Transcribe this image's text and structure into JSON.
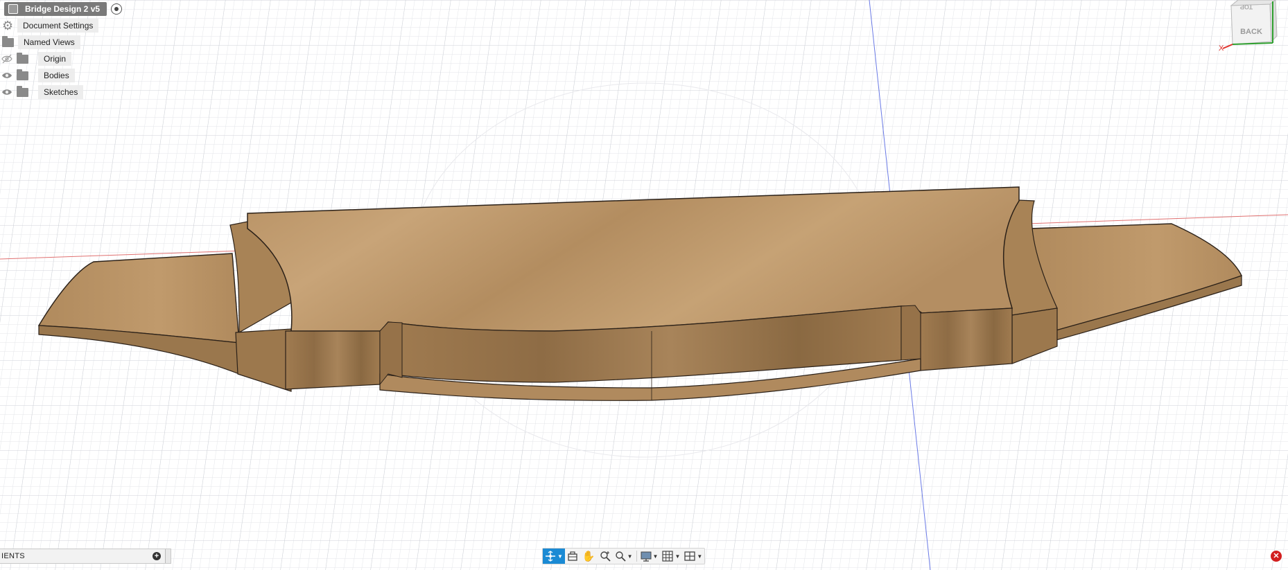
{
  "document": {
    "title": "Bridge Design 2 v5"
  },
  "browser": {
    "document_settings": "Document Settings",
    "named_views": "Named Views",
    "items": [
      {
        "label": "Origin",
        "visible": false
      },
      {
        "label": "Bodies",
        "visible": true
      },
      {
        "label": "Sketches",
        "visible": true
      }
    ]
  },
  "viewcube": {
    "face_label": "BACK",
    "top_face_label": "TOP",
    "axis_x": "X",
    "axis_x_color": "#e0302a",
    "axis_y_color": "#2fa02f"
  },
  "comments": {
    "label": "IENTS",
    "add_symbol": "+"
  },
  "toolbar": {
    "buttons": [
      {
        "icon": "orbit-icon",
        "active": true,
        "has_menu": true
      },
      {
        "icon": "look-at-icon",
        "active": false,
        "has_menu": false
      },
      {
        "icon": "pan-icon",
        "active": false,
        "has_menu": false
      },
      {
        "icon": "zoom-icon",
        "active": false,
        "has_menu": false
      },
      {
        "icon": "fit-icon",
        "active": false,
        "has_menu": true
      },
      {
        "icon": "display-settings-icon",
        "active": false,
        "has_menu": true
      },
      {
        "icon": "grid-snap-icon",
        "active": false,
        "has_menu": true
      },
      {
        "icon": "viewports-icon",
        "active": false,
        "has_menu": true
      }
    ]
  },
  "colors": {
    "wood_top": "#c19a6b",
    "wood_side": "#a27d52",
    "wood_dark": "#8a6a45",
    "grid_minor": "#e2e4e8",
    "grid_major": "#c9ccd2",
    "axis_red": "#e05050",
    "axis_blue": "#5a6ee0",
    "accent": "#1a8ad4"
  }
}
